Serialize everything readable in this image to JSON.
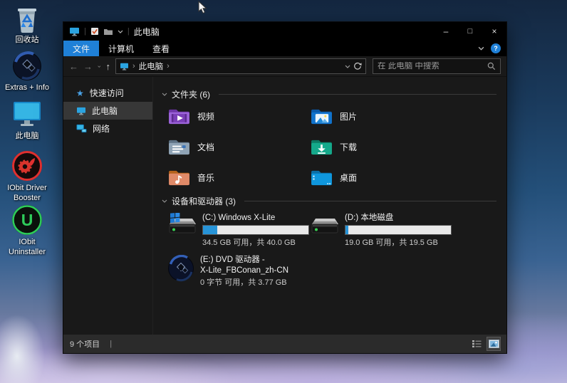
{
  "colors": {
    "accent_blue": "#1f80d7",
    "drive_bar_fill": "#2794d8",
    "drive_bar_track": "#e9e9e9",
    "selection_gray": "#373737",
    "window_bg": "#191919",
    "titlebar_bg": "#000000"
  },
  "desktop": {
    "icons": [
      {
        "label": "回收站",
        "icon": "recycle-bin-icon"
      },
      {
        "label": "Extras + Info",
        "icon": "extras-info-icon"
      },
      {
        "label": "此电脑",
        "icon": "this-pc-icon"
      },
      {
        "label": "IObit Driver Booster",
        "icon": "driver-booster-icon"
      },
      {
        "label": "IObit Uninstaller",
        "icon": "uninstaller-icon"
      }
    ]
  },
  "window": {
    "title": "此电脑",
    "controls": {
      "minimize": "–",
      "maximize": "□",
      "close": "×"
    },
    "menu": {
      "tabs": [
        {
          "label": "文件"
        },
        {
          "label": "计算机"
        },
        {
          "label": "查看"
        }
      ],
      "help": "?"
    },
    "nav": {
      "back": "←",
      "forward": "→",
      "up": "↑",
      "breadcrumb_root": "此电脑",
      "breadcrumb_separator": "›",
      "search_placeholder": "在 此电脑 中搜索"
    },
    "sidebar": {
      "items": [
        {
          "label": "快速访问"
        },
        {
          "label": "此电脑"
        },
        {
          "label": "网络"
        }
      ]
    },
    "main": {
      "folders_header": "文件夹 (6)",
      "folders": [
        {
          "label": "视频"
        },
        {
          "label": "图片"
        },
        {
          "label": "文档"
        },
        {
          "label": "下载"
        },
        {
          "label": "音乐"
        },
        {
          "label": "桌面"
        }
      ],
      "drives_header": "设备和驱动器 (3)",
      "drives": [
        {
          "name": "(C:) Windows X-Lite",
          "caption": "34.5 GB 可用，共 40.0 GB",
          "fill_style": "width:13.8%"
        },
        {
          "name": "(D:) 本地磁盘",
          "caption": "19.0 GB 可用，共 19.5 GB",
          "fill_style": "width:2.6%"
        },
        {
          "name": "(E:) DVD 驱动器 -",
          "name2": "X-Lite_FBConan_zh-CN",
          "caption": "0 字节 可用，共 3.77 GB"
        }
      ]
    },
    "status": {
      "count": "9 个项目",
      "separator": "|"
    }
  }
}
